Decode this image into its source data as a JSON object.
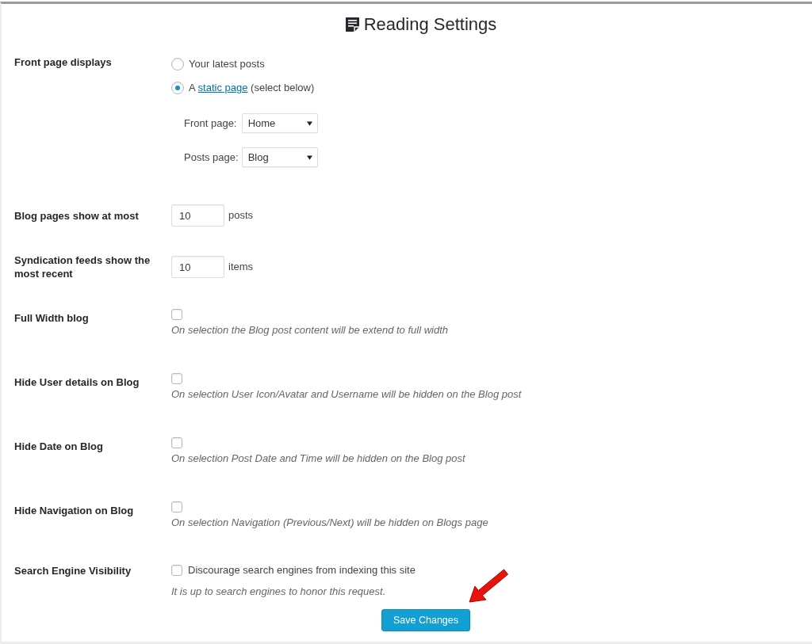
{
  "header": {
    "title": "Reading Settings"
  },
  "settings": [
    {
      "kind": "radio_group",
      "label": "Front page displays",
      "options": [
        {
          "text": "Your latest posts",
          "selected": false
        },
        {
          "text": "A",
          "link": "static page",
          "text_after": "(select below)",
          "selected": true
        }
      ],
      "selects": [
        {
          "label": "Front page:",
          "value": "Home"
        },
        {
          "label": "Posts page:",
          "value": "Blog"
        }
      ]
    },
    {
      "kind": "number",
      "label": "Blog pages show at most",
      "value": "10",
      "unit": "posts"
    },
    {
      "kind": "number",
      "label": "Syndication feeds show the most recent",
      "value": "10",
      "unit": "items"
    },
    {
      "kind": "checkbox",
      "label": "Full Width blog",
      "checked": false,
      "description": "On selection the Blog post content will be extend to full width"
    },
    {
      "kind": "checkbox",
      "label": "Hide User details on Blog",
      "checked": false,
      "description": "On selection User Icon/Avatar and Username will be hidden on the Blog post"
    },
    {
      "kind": "checkbox",
      "label": "Hide Date on Blog",
      "checked": false,
      "description": "On selection Post Date and Time will be hidden on the Blog post"
    },
    {
      "kind": "checkbox",
      "label": "Hide Navigation on Blog",
      "checked": false,
      "description": "On selection Navigation (Previous/Next) will be hidden on Blogs page"
    },
    {
      "kind": "checkbox_option",
      "label": "Search Engine Visibility",
      "checked": false,
      "option": "Discourage search engines from indexing this site",
      "description": "It is up to search engines to honor this request."
    }
  ],
  "save_button": "Save Changes"
}
